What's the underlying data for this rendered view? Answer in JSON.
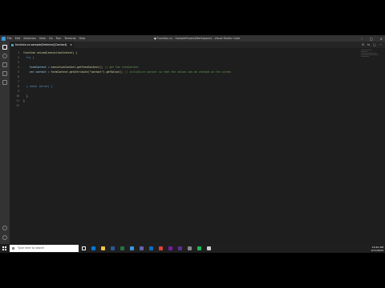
{
  "window": {
    "menu": [
      "File",
      "Edit",
      "Selection",
      "View",
      "Go",
      "Run",
      "Terminal",
      "Help"
    ],
    "title": "● Function.cs - SampleProject(Workspace) - Visual Studio Code"
  },
  "tab": {
    "label": "function.cs sample(Selector)[Contact]",
    "close": "×"
  },
  "tab_actions": [
    "⊡",
    "⇆",
    "□",
    "···"
  ],
  "code": {
    "lines": [
      "1",
      "2",
      "3",
      "4",
      "5",
      "6",
      "7",
      "8",
      "9",
      "10",
      "11",
      "12"
    ],
    "l1": "function onLoad(executionContext) {",
    "l2": "  try {",
    "l4_a": "    formContext = ",
    "l4_b": "executionContext.getFormContext();",
    "l4_c": " // get the formContext",
    "l5_a": "    var contact = ",
    "l5_b": "formContext.getAttribute(\"contact\").getValue();",
    "l5_c": " // initialize contact so that the values can be checked on the screen",
    "l8": "  } catch (error) {",
    "l10": "  }",
    "l11": "}"
  },
  "statusbar": {
    "left": "⊗ 0 ⚠ 0",
    "right": [
      "Ln 5, Col 73",
      "Spaces: 4",
      "UTF-8",
      "CRLF",
      "JavaScript",
      "🔔"
    ]
  },
  "taskbar": {
    "search_placeholder": "Type here to search",
    "time": "10:41 AM",
    "date": "2/17/2022"
  },
  "colors": {
    "status": "#68217a",
    "editor_bg": "#1e1e1e",
    "activity": "#333333"
  }
}
